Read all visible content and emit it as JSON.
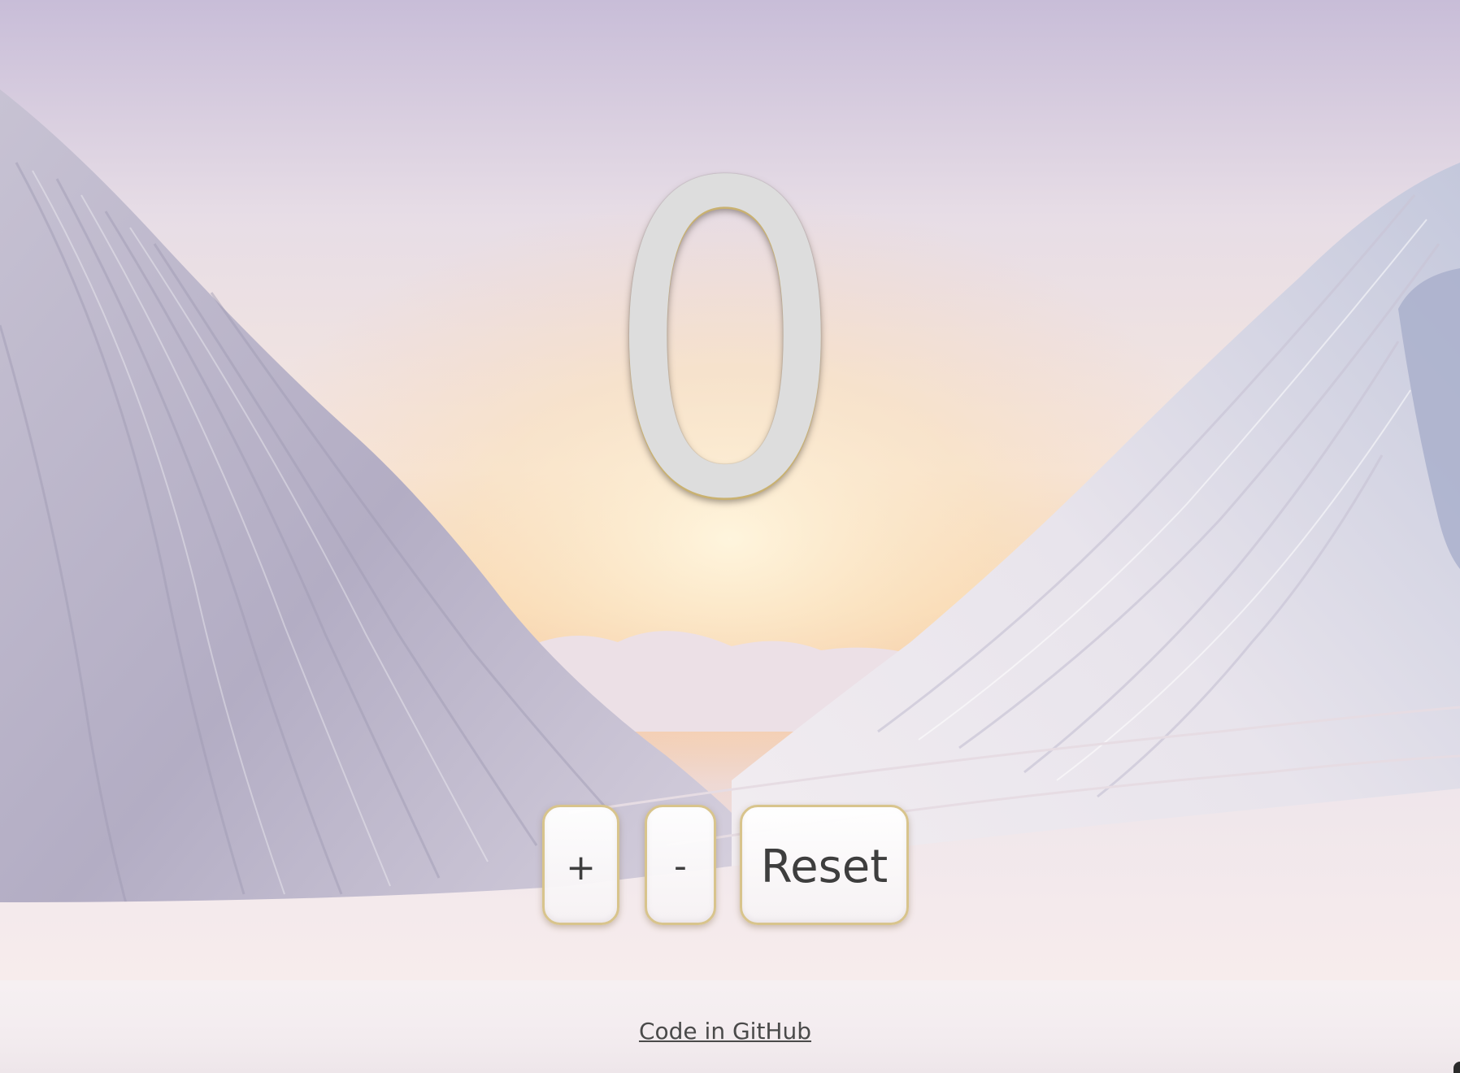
{
  "counter": {
    "value": "0"
  },
  "controls": {
    "increment_label": "+",
    "decrement_label": "-",
    "reset_label": "Reset"
  },
  "footer": {
    "link_text": "Code in GitHub"
  }
}
